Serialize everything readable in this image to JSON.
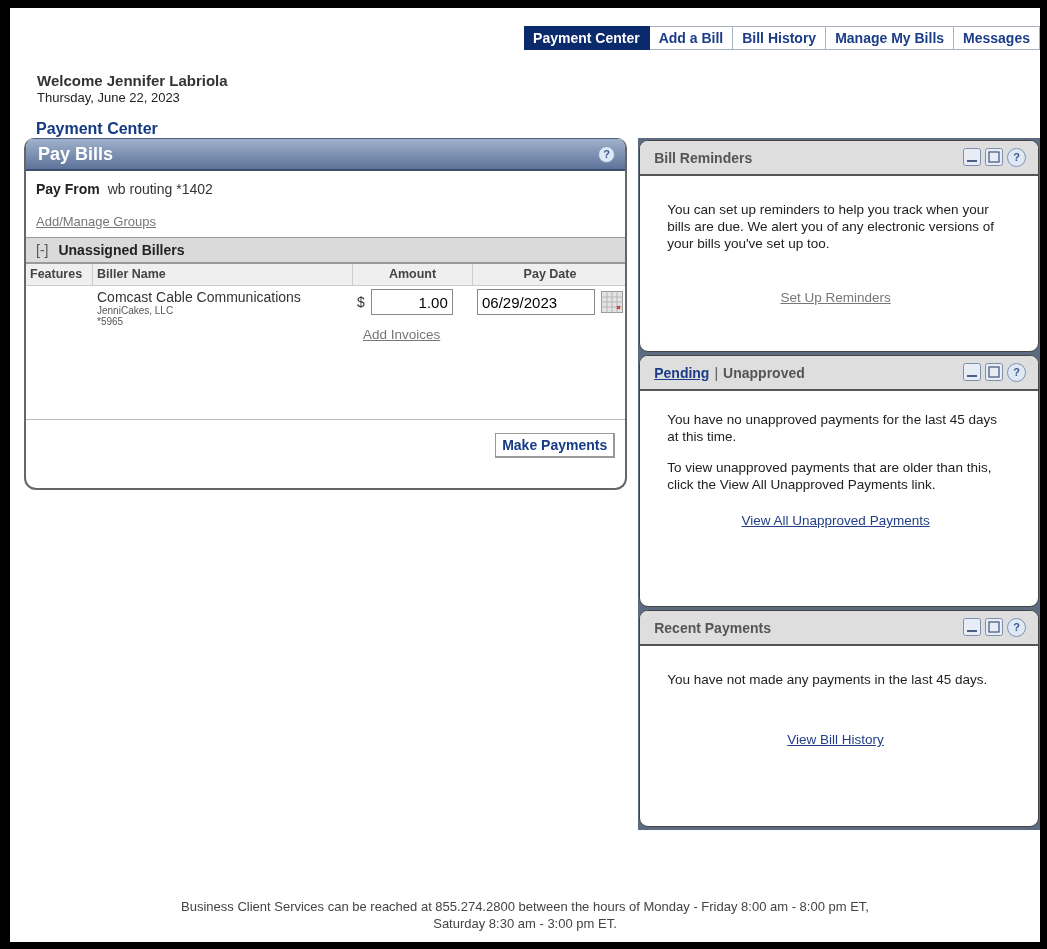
{
  "nav_tabs": [
    {
      "label": "Payment Center",
      "selected": true
    },
    {
      "label": "Add a Bill",
      "selected": false
    },
    {
      "label": "Bill History",
      "selected": false
    },
    {
      "label": "Manage My Bills",
      "selected": false
    },
    {
      "label": "Messages",
      "selected": false
    }
  ],
  "welcome": {
    "greeting": "Welcome Jennifer Labriola",
    "date": "Thursday, June 22, 2023"
  },
  "page_title": "Payment Center",
  "pay_bills": {
    "title": "Pay Bills",
    "help": "?",
    "pay_from_label": "Pay From",
    "pay_from_value": "wb routing *1402",
    "groups_link": "Add/Manage Groups",
    "group": {
      "toggle": "[-]",
      "name": "Unassigned Billers",
      "expanded": true
    },
    "columns": [
      "Features",
      "Biller Name",
      "Amount",
      "Pay Date"
    ],
    "rows": [
      {
        "biller": "Comcast Cable Communications",
        "company": "JenniCakes, LLC",
        "account": "*5965",
        "currency": "$",
        "amount": "1.00",
        "pay_date": "06/29/2023",
        "invoices_link": "Add Invoices"
      }
    ],
    "submit": "Make Payments"
  },
  "widgets": [
    {
      "kind": "plain",
      "title": "Bill Reminders",
      "paragraphs": [
        "You can set up reminders to help you track when your bills are due. We alert you of any electronic versions of your bills you've set up too."
      ],
      "link": "Set Up Reminders",
      "visited": true,
      "help": "?"
    },
    {
      "kind": "tabs",
      "tabs": [
        {
          "label": "Pending",
          "selected": false
        },
        {
          "label": "Unapproved",
          "selected": true
        }
      ],
      "separator": "|",
      "paragraphs": [
        "You have no unapproved payments for the last 45 days at this time.",
        "To view unapproved payments that are older than this, click the View All Unapproved Payments link."
      ],
      "link": "View All Unapproved Payments",
      "visited": false,
      "help": "?"
    },
    {
      "kind": "plain",
      "title": "Recent Payments",
      "paragraphs": [
        "You have not made any payments in the last 45 days."
      ],
      "link": "View Bill History",
      "visited": false,
      "help": "?"
    }
  ],
  "footer": [
    "Business Client Services can be reached at 855.274.2800 between the hours of Monday - Friday 8:00 am - 8:00 pm ET,",
    "Saturday 8:30 am - 3:00 pm ET."
  ]
}
